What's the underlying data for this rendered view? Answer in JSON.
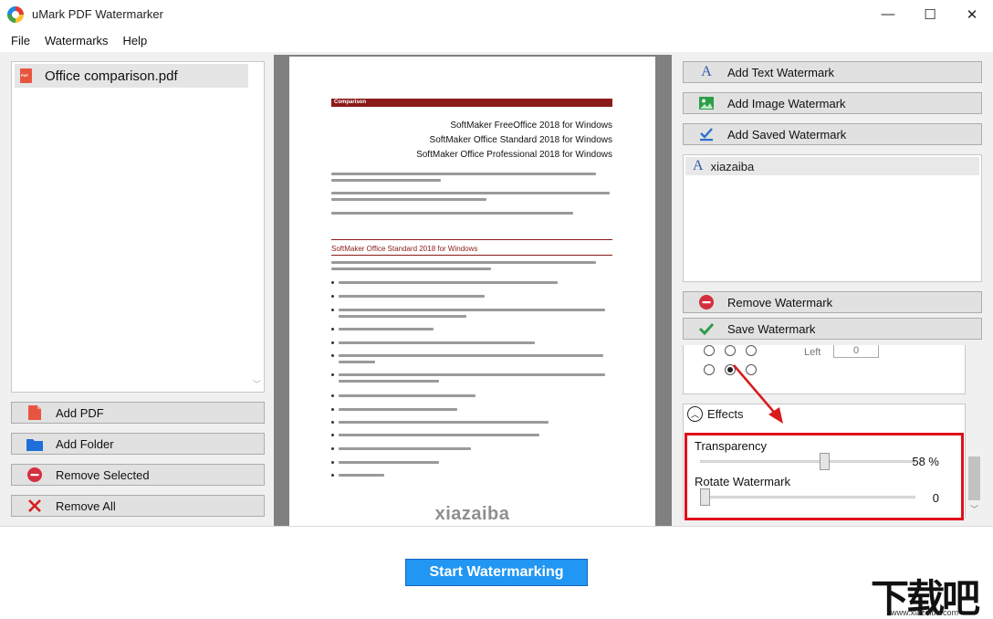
{
  "window": {
    "title": "uMark PDF Watermarker",
    "minimize": "—",
    "maximize": "☐",
    "close": "✕"
  },
  "menu": [
    "File",
    "Watermarks",
    "Help"
  ],
  "files": [
    {
      "name": "Office comparison.pdf"
    }
  ],
  "left_buttons": {
    "add_pdf": "Add PDF",
    "add_folder": "Add Folder",
    "remove_selected": "Remove Selected",
    "remove_all": "Remove All"
  },
  "preview_page": {
    "section_label": "Comparison",
    "titles": [
      "SoftMaker FreeOffice 2018 for Windows",
      "SoftMaker Office Standard 2018 for Windows",
      "SoftMaker Office Professional 2018 for Windows"
    ],
    "heading": "SoftMaker Office Standard 2018 for Windows",
    "watermark_text": "xiazaiba"
  },
  "right_buttons": {
    "add_text": "Add Text Watermark",
    "add_image": "Add Image Watermark",
    "add_saved": "Add Saved Watermark",
    "remove": "Remove Watermark",
    "save": "Save Watermark"
  },
  "watermarks": [
    {
      "name": "xiazaiba"
    }
  ],
  "position": {
    "left_label": "Left",
    "left_value": "0"
  },
  "effects": {
    "header": "Effects",
    "transparency_label": "Transparency",
    "transparency_value": "58 %",
    "transparency_fraction": 0.58,
    "rotate_label": "Rotate Watermark",
    "rotate_value": "0",
    "rotate_fraction": 0
  },
  "start_button": "Start Watermarking",
  "corner_logo": {
    "big": "下载吧",
    "small": "www.xiazaiba.com"
  },
  "colors": {
    "accent": "#2196f3",
    "highlight": "#e0101a",
    "arrow": "#d81b1b"
  }
}
